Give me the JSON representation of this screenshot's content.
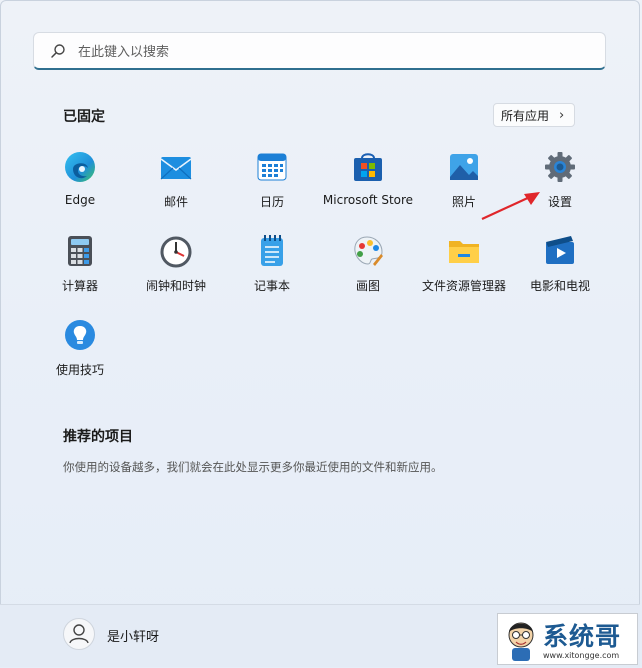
{
  "search": {
    "placeholder": "在此键入以搜索",
    "icon": "search-icon"
  },
  "pinned": {
    "title": "已固定",
    "all_apps_label": "所有应用",
    "apps": [
      {
        "label": "Edge",
        "icon": "edge-icon"
      },
      {
        "label": "邮件",
        "icon": "mail-icon"
      },
      {
        "label": "日历",
        "icon": "calendar-icon"
      },
      {
        "label": "Microsoft Store",
        "icon": "store-icon"
      },
      {
        "label": "照片",
        "icon": "photos-icon"
      },
      {
        "label": "设置",
        "icon": "settings-icon"
      },
      {
        "label": "计算器",
        "icon": "calculator-icon"
      },
      {
        "label": "闹钟和时钟",
        "icon": "clock-icon"
      },
      {
        "label": "记事本",
        "icon": "notepad-icon"
      },
      {
        "label": "画图",
        "icon": "paint-icon"
      },
      {
        "label": "文件资源管理器",
        "icon": "folder-icon"
      },
      {
        "label": "电影和电视",
        "icon": "movies-icon"
      },
      {
        "label": "使用技巧",
        "icon": "tips-icon"
      }
    ]
  },
  "recommended": {
    "title": "推荐的项目",
    "description": "你使用的设备越多，我们就会在此处显示更多你最近使用的文件和新应用。"
  },
  "user": {
    "name": "是小轩呀"
  },
  "watermark": {
    "text": "系统哥",
    "url": "www.xitongge.com"
  },
  "colors": {
    "accent": "#2f6f8f",
    "annotation_arrow": "#e0262b",
    "watermark_text": "#1d5a92"
  }
}
